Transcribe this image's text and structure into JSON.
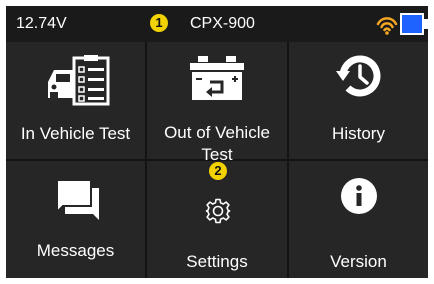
{
  "status": {
    "voltage": "12.74V",
    "device_name": "CPX-900",
    "wifi_icon": "wifi-icon",
    "battery_icon": "battery-icon",
    "accent_color": "#f5a623",
    "battery_color": "#1e63ff"
  },
  "markers": {
    "one": "1",
    "two": "2"
  },
  "menu": {
    "in_vehicle_test": {
      "label": "In Vehicle Test",
      "icon": "car-checklist-icon"
    },
    "out_of_vehicle_test": {
      "label_line1": "Out of Vehicle",
      "label_line2": "Test",
      "icon": "battery-test-icon"
    },
    "history": {
      "label": "History",
      "icon": "history-icon"
    },
    "messages": {
      "label": "Messages",
      "icon": "messages-icon"
    },
    "settings": {
      "label": "Settings",
      "icon": "gear-icon"
    },
    "version": {
      "label": "Version",
      "icon": "info-icon"
    }
  }
}
